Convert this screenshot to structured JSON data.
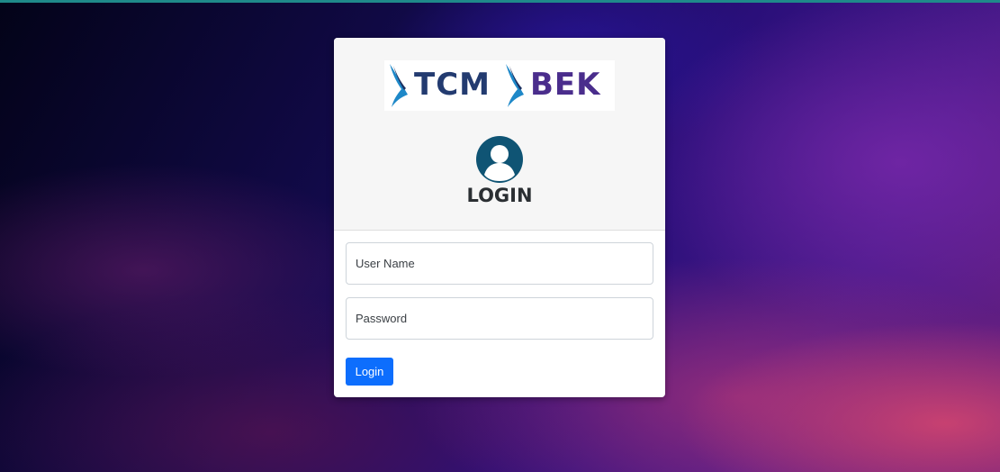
{
  "brand": {
    "word_left": "TCM",
    "word_right": "BEK",
    "logo_colors": {
      "swoosh": "#1e88c8",
      "word_left": "#233b70",
      "word_right": "#4a2d8c"
    }
  },
  "login": {
    "title": "LOGIN",
    "icon": "user-circle-icon",
    "username_placeholder": "User Name",
    "username_value": "",
    "password_placeholder": "Password",
    "password_value": "",
    "submit_label": "Login"
  },
  "colors": {
    "primary_button": "#0d6efd",
    "user_icon": "#0f5474",
    "card_header": "#f6f6f6"
  }
}
